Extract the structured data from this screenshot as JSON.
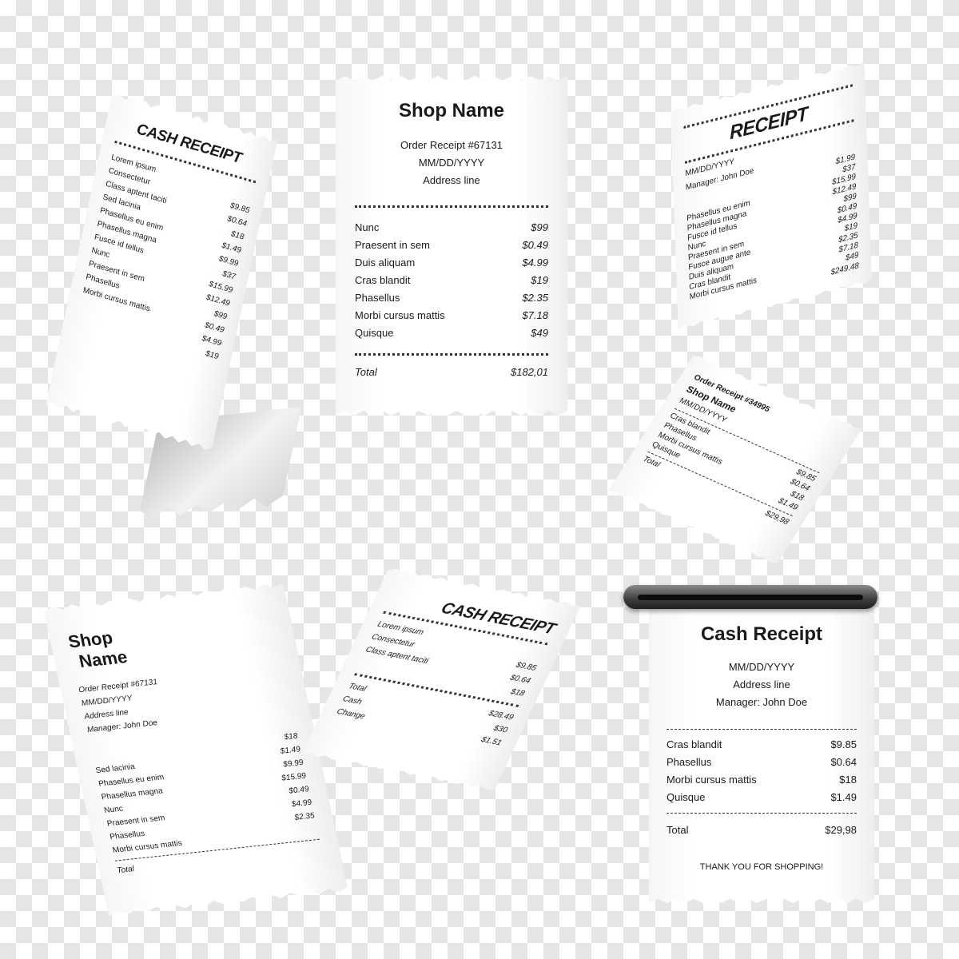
{
  "receipt_center": {
    "title": "Shop Name",
    "order": "Order Receipt #67131",
    "date": "MM/DD/YYYY",
    "address": "Address line",
    "items": [
      {
        "name": "Nunc",
        "price": "$99"
      },
      {
        "name": "Praesent in sem",
        "price": "$0.49"
      },
      {
        "name": "Duis aliquam",
        "price": "$4.99"
      },
      {
        "name": "Cras blandit",
        "price": "$19"
      },
      {
        "name": "Phasellus",
        "price": "$2.35"
      },
      {
        "name": "Morbi cursus mattis",
        "price": "$7.18"
      },
      {
        "name": "Quisque",
        "price": "$49"
      }
    ],
    "total_label": "Total",
    "total_value": "$182,01"
  },
  "receipt_top_left": {
    "title": "CASH RECEIPT",
    "items": [
      {
        "name": "Lorem ipsum",
        "price": ""
      },
      {
        "name": "Consectetur",
        "price": "$9.85"
      },
      {
        "name": "Class aptent taciti",
        "price": "$0.64"
      },
      {
        "name": "Sed lacinia",
        "price": "$18"
      },
      {
        "name": "Phasellus eu enim",
        "price": "$1.49"
      },
      {
        "name": "Phasellus magna",
        "price": "$9.99"
      },
      {
        "name": "Fusce id tellus",
        "price": "$37"
      },
      {
        "name": "Nunc",
        "price": "$15.99"
      },
      {
        "name": "Praesent in sem",
        "price": "$12.49"
      },
      {
        "name": "Phasellus",
        "price": "$99"
      },
      {
        "name": "Morbi cursus mattis",
        "price": "$0.49"
      },
      {
        "name": "",
        "price": "$4.99"
      },
      {
        "name": "",
        "price": "$19"
      }
    ]
  },
  "receipt_top_right": {
    "title": "RECEIPT",
    "date": "MM/DD/YYYY",
    "manager": "Manager: John Doe",
    "items": [
      {
        "name": "",
        "price": "$1.99"
      },
      {
        "name": "",
        "price": "$37"
      },
      {
        "name": "Phasellus eu enim",
        "price": "$15.99"
      },
      {
        "name": "Phasellus magna",
        "price": "$12.49"
      },
      {
        "name": "Fusce id tellus",
        "price": "$99"
      },
      {
        "name": "Nunc",
        "price": "$0.49"
      },
      {
        "name": "Praesent in sem",
        "price": "$4.99"
      },
      {
        "name": "Fusce augue ante",
        "price": "$19"
      },
      {
        "name": "Duis aliquam",
        "price": "$2.35"
      },
      {
        "name": "Cras blandit",
        "price": "$7.18"
      },
      {
        "name": "Morbi cursus mattis",
        "price": "$49"
      }
    ],
    "total_value": "$249.48"
  },
  "receipt_mid_right": {
    "order": "Order Receipt #34995",
    "shop": "Shop Name",
    "date": "MM/DD/YYYY",
    "items": [
      {
        "name": "Cras blandit",
        "price": "$9.85"
      },
      {
        "name": "Phasellus",
        "price": "$0.64"
      },
      {
        "name": "Morbi cursus mattis",
        "price": "$18"
      },
      {
        "name": "Quisque",
        "price": "$1.49"
      }
    ],
    "total_label": "Total",
    "total_value": "$29,98"
  },
  "receipt_bottom_left": {
    "title_1": "Shop",
    "title_2": "Name",
    "order": "Order Receipt #67131",
    "date": "MM/DD/YYYY",
    "address": "Address line",
    "manager": "Manager: John Doe",
    "items": [
      {
        "name": "",
        "price": "$18"
      },
      {
        "name": "Sed lacinia",
        "price": "$1.49"
      },
      {
        "name": "Phasellus eu enim",
        "price": "$9.99"
      },
      {
        "name": "Phasellus magna",
        "price": "$15.99"
      },
      {
        "name": "Nunc",
        "price": "$0.49"
      },
      {
        "name": "Praesent in sem",
        "price": "$4.99"
      },
      {
        "name": "Phasellus",
        "price": "$2.35"
      },
      {
        "name": "Morbi cursus mattis",
        "price": ""
      }
    ],
    "total_label": "Total"
  },
  "receipt_bottom_middle": {
    "title": "CASH RECEIPT",
    "items": [
      {
        "name": "Lorem ipsum",
        "price": ""
      },
      {
        "name": "Consectetur",
        "price": "$9.85"
      },
      {
        "name": "Class aptent taciti",
        "price": "$0.64"
      },
      {
        "name": "",
        "price": "$18"
      }
    ],
    "totals": [
      {
        "name": "Total",
        "price": "$28.49"
      },
      {
        "name": "Cash",
        "price": "$30"
      },
      {
        "name": "Change",
        "price": "$1.51"
      }
    ]
  },
  "receipt_bottom_right": {
    "title": "Cash Receipt",
    "date": "MM/DD/YYYY",
    "address": "Address line",
    "manager": "Manager: John Doe",
    "items": [
      {
        "name": "Cras blandit",
        "price": "$9.85"
      },
      {
        "name": "Phasellus",
        "price": "$0.64"
      },
      {
        "name": "Morbi cursus mattis",
        "price": "$18"
      },
      {
        "name": "Quisque",
        "price": "$1.49"
      }
    ],
    "total_label": "Total",
    "total_value": "$29,98",
    "footer": "THANK YOU FOR SHOPPING!"
  }
}
